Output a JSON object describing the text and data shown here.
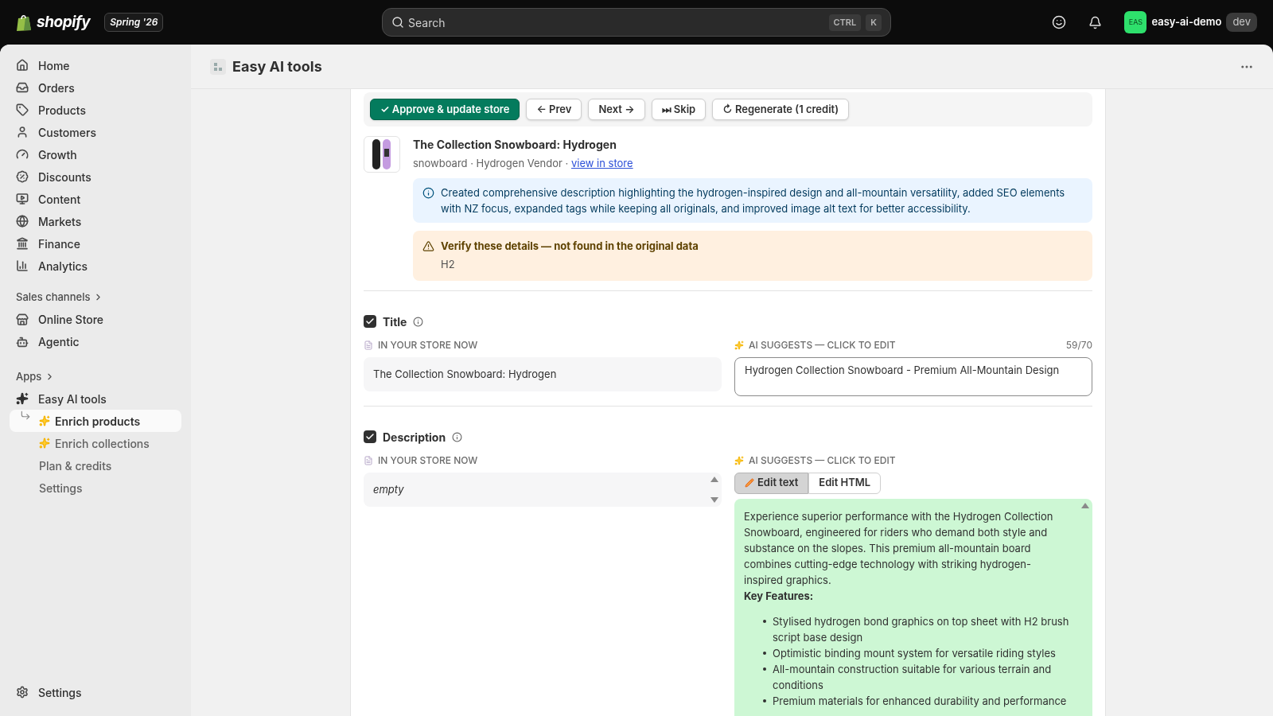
{
  "topbar": {
    "brand": "shopify",
    "badge": "Spring '26",
    "search": {
      "placeholder": "Search",
      "keys": [
        "CTRL",
        "K"
      ]
    },
    "store": {
      "initials": "EAS",
      "name": "easy-ai-demo",
      "tag": "dev"
    }
  },
  "sidebar": {
    "items": [
      {
        "label": "Home"
      },
      {
        "label": "Orders"
      },
      {
        "label": "Products"
      },
      {
        "label": "Customers"
      },
      {
        "label": "Growth"
      },
      {
        "label": "Discounts"
      },
      {
        "label": "Content"
      },
      {
        "label": "Markets"
      },
      {
        "label": "Finance"
      },
      {
        "label": "Analytics"
      }
    ],
    "sales_channels": {
      "heading": "Sales channels",
      "items": [
        {
          "label": "Online Store"
        },
        {
          "label": "Agentic"
        }
      ]
    },
    "apps": {
      "heading": "Apps",
      "app": {
        "label": "Easy AI tools",
        "children": [
          {
            "label": "Enrich products",
            "kind": "sparkle",
            "selected": true
          },
          {
            "label": "Enrich collections",
            "kind": "sparkle",
            "selected": false
          },
          {
            "label": "Plan & credits",
            "kind": "plain",
            "selected": false
          },
          {
            "label": "Settings",
            "kind": "plain",
            "selected": false
          }
        ]
      }
    },
    "footer": "Settings"
  },
  "page": {
    "title": "Easy AI tools"
  },
  "toolbar": [
    {
      "label": "✓ Approve & update store",
      "kind": "primary"
    },
    {
      "label": "← Prev",
      "kind": "secondary"
    },
    {
      "label": "Next →",
      "kind": "secondary"
    },
    {
      "label": "⏭ Skip",
      "kind": "secondary"
    },
    {
      "label": "↻ Regenerate (1 credit)",
      "kind": "secondary"
    }
  ],
  "product": {
    "name": "The Collection Snowboard: Hydrogen",
    "meta": "snowboard · Hydrogen Vendor · ",
    "link": "view in store",
    "info": "Created comprehensive description highlighting the hydrogen-inspired design and all-mountain versatility, added SEO elements with NZ focus, expanded tags while keeping all originals, and improved image alt text for better accessibility.",
    "warning": {
      "title": "Verify these details — not found in the original data",
      "items": [
        "H2"
      ]
    }
  },
  "fields": [
    {
      "kind": "title",
      "label": "Title",
      "checked": true,
      "current_label": "IN YOUR STORE NOW",
      "current": "The Collection Snowboard: Hydrogen",
      "suggest_label": "AI SUGGESTS — CLICK TO EDIT",
      "count": "59/70",
      "suggestion": "Hydrogen Collection Snowboard - Premium All-Mountain Design"
    },
    {
      "kind": "description",
      "label": "Description",
      "checked": true,
      "current_label": "IN YOUR STORE NOW",
      "current": "empty",
      "suggest_label": "AI SUGGESTS — CLICK TO EDIT",
      "tabs": [
        {
          "label": "Edit text",
          "selected": true
        },
        {
          "label": "Edit HTML",
          "selected": false
        }
      ],
      "paragraph": "Experience superior performance with the Hydrogen Collection Snowboard, engineered for riders who demand both style and substance on the slopes. This premium all-mountain board combines cutting-edge technology with striking hydrogen-inspired graphics.",
      "heading": "Key Features:",
      "bullets": [
        "Stylised hydrogen bond graphics on top sheet with H2 brush script base design",
        "Optimistic binding mount system for versatile riding styles",
        "All-mountain construction suitable for various terrain and conditions",
        "Premium materials for enhanced durability and performance"
      ]
    }
  ]
}
